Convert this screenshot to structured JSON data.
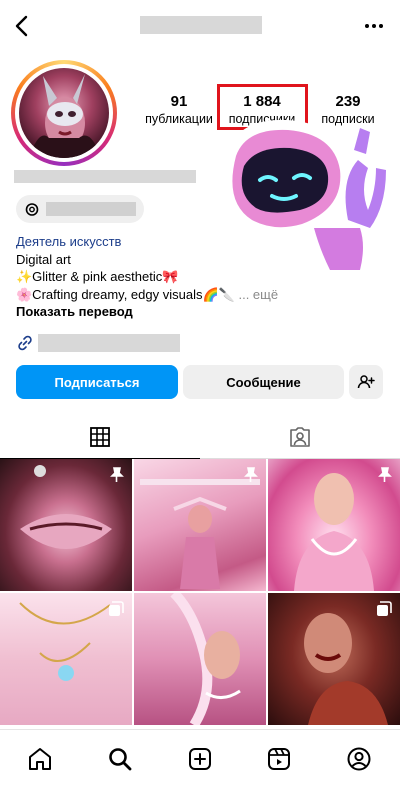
{
  "header": {
    "back_icon": "chevron-left-icon",
    "more_icon": "more-dots-icon"
  },
  "stats": {
    "posts": {
      "value": "91",
      "label": "публикации"
    },
    "followers": {
      "value": "1 884",
      "label": "подписчики"
    },
    "following": {
      "value": "239",
      "label": "подписки"
    }
  },
  "bio": {
    "category": "Деятель искусств",
    "line1": "Digital art",
    "line2": "✨Glitter & pink aesthetic🎀",
    "line3": "🌸Crafting dreamy, edgy visuals🌈🔪",
    "more": "... ещё",
    "translate": "Показать перевод"
  },
  "actions": {
    "follow": "Подписаться",
    "message": "Сообщение"
  },
  "colors": {
    "accent": "#0095f6",
    "highlight": "#e0141c"
  },
  "bottom_nav": [
    "home-icon",
    "search-icon",
    "create-icon",
    "reels-icon",
    "profile-icon"
  ]
}
